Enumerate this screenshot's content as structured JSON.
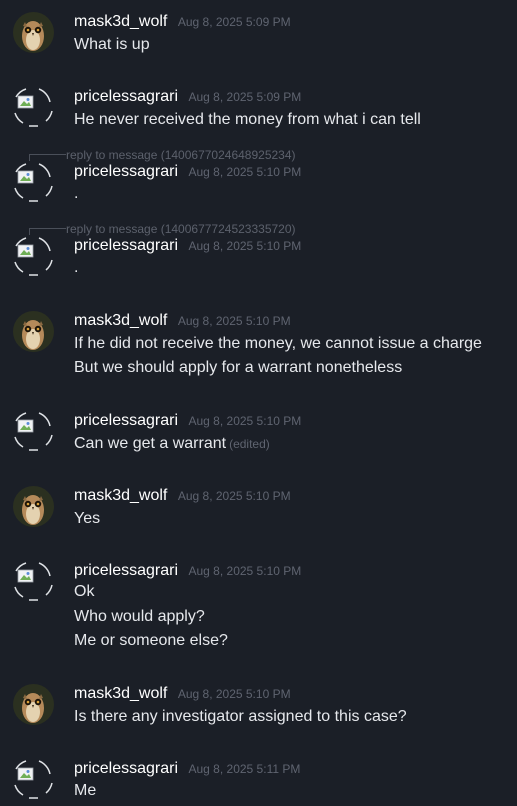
{
  "messages": [
    {
      "username": "mask3d_wolf",
      "timestamp": "Aug 8, 2025 5:09 PM",
      "avatar": "owl-avatar",
      "lines": [
        "What is up"
      ]
    },
    {
      "username": "pricelessagrari",
      "timestamp": "Aug 8, 2025 5:09 PM",
      "avatar": "broken-image-icon",
      "lines": [
        "He never received the money from what i can tell"
      ]
    },
    {
      "username": "pricelessagrari",
      "timestamp": "Aug 8, 2025 5:10 PM",
      "avatar": "broken-image-icon",
      "reply": "reply to message (1400677024648925234)",
      "lines": [
        "."
      ]
    },
    {
      "username": "pricelessagrari",
      "timestamp": "Aug 8, 2025 5:10 PM",
      "avatar": "broken-image-icon",
      "reply": "reply to message (1400677724523335720)",
      "lines": [
        "."
      ]
    },
    {
      "username": "mask3d_wolf",
      "timestamp": "Aug 8, 2025 5:10 PM",
      "avatar": "owl-avatar",
      "lines": [
        "If he did not receive the money, we cannot issue a charge",
        "But we should apply for a warrant nonetheless"
      ]
    },
    {
      "username": "pricelessagrari",
      "timestamp": "Aug 8, 2025 5:10 PM",
      "avatar": "broken-image-icon",
      "lines": [
        "Can we get a warrant"
      ],
      "edited": "(edited)"
    },
    {
      "username": "mask3d_wolf",
      "timestamp": "Aug 8, 2025 5:10 PM",
      "avatar": "owl-avatar",
      "lines": [
        "Yes"
      ]
    },
    {
      "username": "pricelessagrari",
      "timestamp": "Aug 8, 2025 5:10 PM",
      "avatar": "broken-image-icon",
      "lines": [
        "Ok",
        "Who would apply?",
        "Me or someone else?"
      ]
    },
    {
      "username": "mask3d_wolf",
      "timestamp": "Aug 8, 2025 5:10 PM",
      "avatar": "owl-avatar",
      "lines": [
        "Is there any investigator assigned to this case?"
      ]
    },
    {
      "username": "pricelessagrari",
      "timestamp": "Aug 8, 2025 5:11 PM",
      "avatar": "broken-image-icon",
      "lines": [
        "Me"
      ]
    }
  ]
}
